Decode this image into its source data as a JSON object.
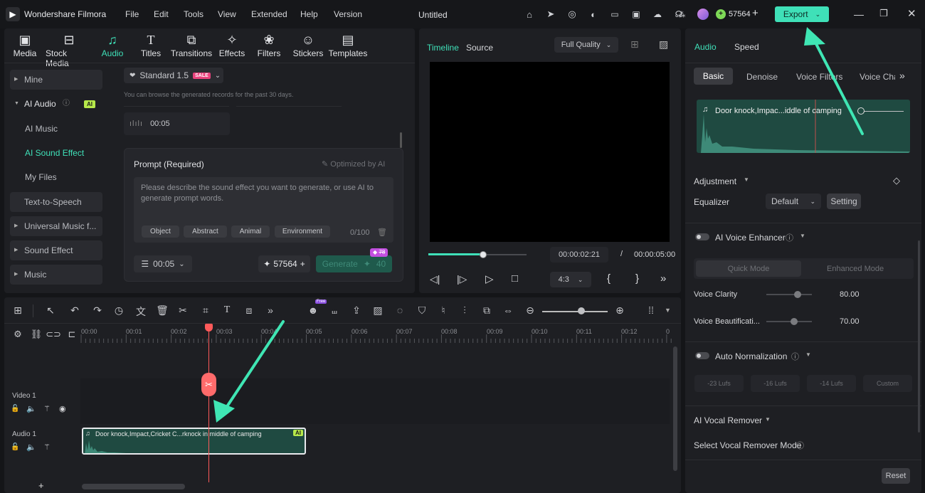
{
  "app": {
    "name": "Wondershare Filmora",
    "project": "Untitled",
    "credits": "57564",
    "export_label": "Export"
  },
  "menu": [
    "File",
    "Edit",
    "Tools",
    "View",
    "Extended",
    "Help",
    "Version"
  ],
  "toolbar": [
    "Media",
    "Stock Media",
    "Audio",
    "Titles",
    "Transitions",
    "Effects",
    "Filters",
    "Stickers",
    "Templates"
  ],
  "sidebar": {
    "mine": "Mine",
    "ai_audio": "AI Audio",
    "ai_badge": "AI",
    "ai_music": "AI Music",
    "ai_sound_effect": "AI Sound Effect",
    "my_files": "My Files",
    "tts": "Text-to-Speech",
    "universal": "Universal Music f...",
    "sound_effect": "Sound Effect",
    "music": "Music"
  },
  "generator": {
    "model": "Standard 1.5",
    "sale": "SALE",
    "hint": "You can browse the generated records for the past 30 days.",
    "record_time": "00:05",
    "prompt_title": "Prompt (Required)",
    "optimized": "Optimized by AI",
    "placeholder": "Please describe the sound effect you want to generate, or use AI to generate prompt words.",
    "tags": [
      "Object",
      "Abstract",
      "Animal",
      "Environment"
    ],
    "count": "0/100",
    "duration": "00:05",
    "credits": "57564",
    "generate": "Generate",
    "cost": "40",
    "old_cost": "78"
  },
  "preview": {
    "tab_timeline": "Timeline",
    "tab_source": "Source",
    "quality": "Full Quality",
    "current": "00:00:02:21",
    "sep": "/",
    "total": "00:00:05:00",
    "aspect": "4:3",
    "progress": 0.55
  },
  "timeline": {
    "ticks": [
      "00:00",
      "00:01",
      "00:02",
      "00:03",
      "00:04",
      "00:05",
      "00:06",
      "00:07",
      "00:08",
      "00:09",
      "00:10",
      "00:11",
      "00:12",
      "0"
    ],
    "video_track": "Video 1",
    "audio_track": "Audio 1",
    "clip_title": "Door knock,Impact,Cricket C...rknock in middle of camping",
    "clip_badge": "AI",
    "free_badge": "Free"
  },
  "right": {
    "tab_audio": "Audio",
    "tab_speed": "Speed",
    "subtabs": [
      "Basic",
      "Denoise",
      "Voice Filters",
      "Voice Cha"
    ],
    "clip_title": "Door knock,Impac...iddle of camping",
    "adjustment": "Adjustment",
    "equalizer": "Equalizer",
    "eq_value": "Default",
    "setting": "Setting",
    "enhancer": "AI Voice Enhancer",
    "quick_mode": "Quick Mode",
    "enhanced_mode": "Enhanced Mode",
    "clarity": "Voice Clarity",
    "clarity_val": "80.00",
    "beautification": "Voice Beautificati...",
    "beauty_val": "70.00",
    "auto_norm": "Auto Normalization",
    "lufs": [
      "-23 Lufs",
      "-16 Lufs",
      "-14 Lufs",
      "Custom"
    ],
    "vocal_remover": "AI Vocal Remover",
    "vocal_mode": "Select Vocal Remover Mode",
    "reset": "Reset"
  }
}
